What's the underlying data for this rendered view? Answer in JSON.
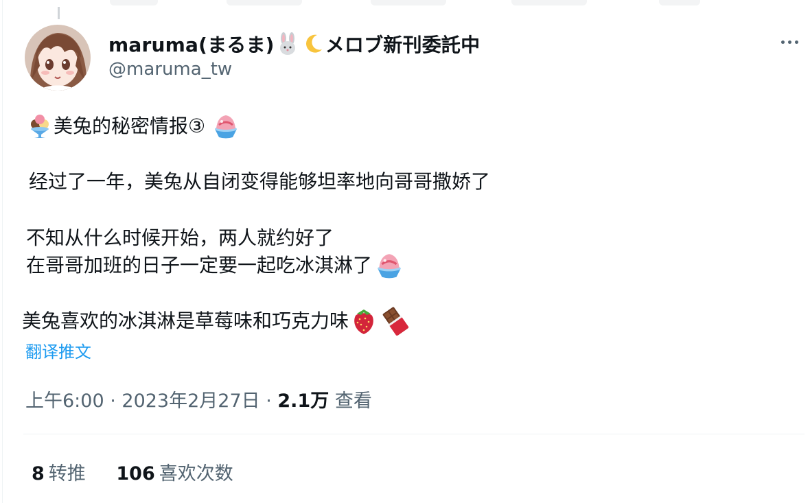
{
  "author": {
    "display_name": "maruma(まるま)",
    "display_name_suffix": "メロブ新刊委託中",
    "handle": "@maruma_tw"
  },
  "tweet": {
    "line1": "美兔的秘密情报③",
    "line2": "经过了一年，美兔从自闭变得能够坦率地向哥哥撒娇了",
    "line3": "不知从什么时候开始，两人就约好了",
    "line4": "在哥哥加班的日子一定要一起吃冰淇淋了",
    "line5": "美兔喜欢的冰淇淋是草莓味和巧克力味"
  },
  "translate_label": "翻译推文",
  "meta": {
    "time": "上午6:00",
    "sep": " · ",
    "date": "2023年2月27日",
    "views_count": "2.1万",
    "views_label": "查看"
  },
  "stats": {
    "retweets_count": "8",
    "retweets_label": "转推",
    "likes_count": "106",
    "likes_label": "喜欢次数"
  },
  "icons": {
    "display_name_1": "rabbit-emoji-icon",
    "display_name_2": "crescent-moon-emoji-icon",
    "line1_start": "ice-cream-emoji-icon",
    "line1_end": "shaved-ice-emoji-icon",
    "line4_end": "shaved-ice-emoji-icon",
    "line5_1": "strawberry-emoji-icon",
    "line5_2": "chocolate-bar-emoji-icon",
    "more": "more-horizontal-icon"
  },
  "colors": {
    "link": "#1d9bf0",
    "secondary_text": "#536471",
    "primary_text": "#0f1419"
  }
}
